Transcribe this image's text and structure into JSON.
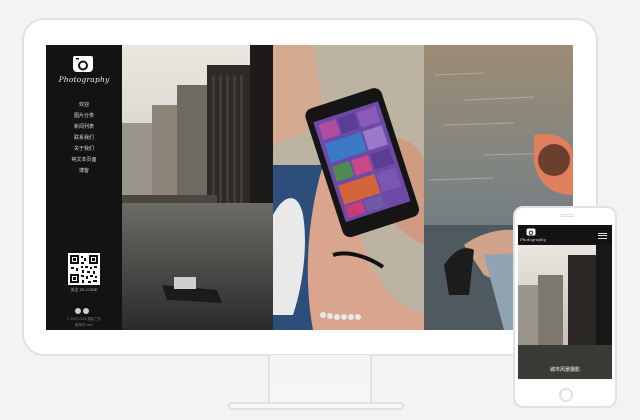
{
  "desktop": {
    "sidebar": {
      "logo_icon": "camera-icon",
      "brand": "Photography",
      "nav_items": [
        {
          "label": "欢迎"
        },
        {
          "label": "图片分类"
        },
        {
          "label": "新闻列表"
        },
        {
          "label": "联系我们"
        },
        {
          "label": "关于我们"
        },
        {
          "label": "纯文本页面"
        },
        {
          "label": "博客"
        }
      ],
      "qr_caption": "关注 ZK-CODE",
      "social_icons": [
        "wechat-icon",
        "weibo-icon"
      ],
      "copyright_line1": "© 2009-2016 摄影工作",
      "copyright_line2": "备案号 xxxx"
    },
    "panels": [
      {
        "name": "canal-city-photo"
      },
      {
        "name": "hands-holding-phone-photo"
      },
      {
        "name": "person-by-sea-photo"
      }
    ]
  },
  "mobile": {
    "brand": "Photography",
    "menu_icon": "hamburger-menu-icon",
    "caption": "城市风景摄影"
  },
  "colors": {
    "page_bg": "#f3f3f3",
    "device_frame": "#e1e1e1",
    "sidebar_bg": "#131313"
  }
}
